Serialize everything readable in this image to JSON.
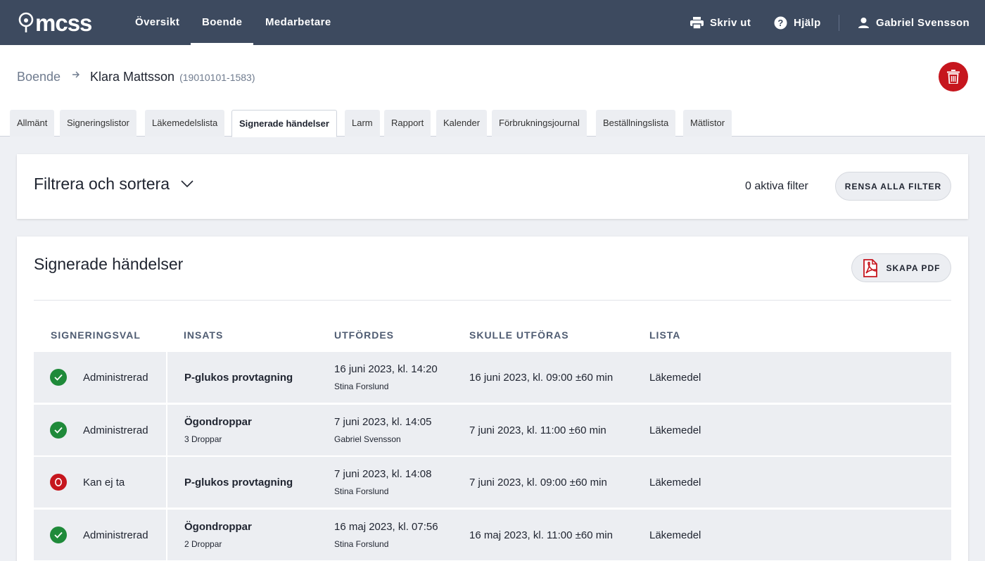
{
  "topbar": {
    "logo": "mcss",
    "nav": [
      "Översikt",
      "Boende",
      "Medarbetare"
    ],
    "active_nav": "Boende",
    "print_label": "Skriv ut",
    "help_label": "Hjälp",
    "user_name": "Gabriel Svensson",
    "bg_color": "#3d4a5f"
  },
  "header": {
    "breadcrumb_link": "Boende",
    "person_name": "Klara Mattsson",
    "person_id": "(19010101-1583)",
    "tabs": [
      "Allmänt",
      "Signeringslistor",
      "Läkemedelslista",
      "Signerade händelser",
      "Larm",
      "Rapport",
      "Kalender",
      "Förbrukningsjournal",
      "Beställningslista",
      "Mätlistor"
    ],
    "active_tab": "Signerade händelser"
  },
  "filter": {
    "title": "Filtrera och sortera",
    "active_count": "0 aktiva filter",
    "clear_label": "RENSA ALLA FILTER"
  },
  "events": {
    "title": "Signerade händelser",
    "pdf_label": "SKAPA PDF",
    "columns": [
      "SIGNERINGSVAL",
      "INSATS",
      "UTFÖRDES",
      "SKULLE UTFÖRAS",
      "LISTA"
    ],
    "rows": [
      {
        "status": "ok",
        "status_label": "Administrerad",
        "insats": "P-glukos provtagning",
        "insats_sub": "",
        "utfordes": "16 juni 2023, kl. 14:20",
        "utfordes_by": "Stina Forslund",
        "skulle": "16 juni 2023, kl. 09:00 ±60 min",
        "lista": "Läkemedel"
      },
      {
        "status": "ok",
        "status_label": "Administrerad",
        "insats": "Ögondroppar",
        "insats_sub": "3 Droppar",
        "utfordes": "7 juni 2023, kl. 14:05",
        "utfordes_by": "Gabriel Svensson",
        "skulle": "7 juni 2023, kl. 11:00 ±60 min",
        "lista": "Läkemedel"
      },
      {
        "status": "no",
        "status_label": "Kan ej ta",
        "insats": "P-glukos provtagning",
        "insats_sub": "",
        "utfordes": "7 juni 2023, kl. 14:08",
        "utfordes_by": "Stina Forslund",
        "skulle": "7 juni 2023, kl. 09:00 ±60 min",
        "lista": "Läkemedel"
      },
      {
        "status": "ok",
        "status_label": "Administrerad",
        "insats": "Ögondroppar",
        "insats_sub": "2 Droppar",
        "utfordes": "16 maj 2023, kl. 07:56",
        "utfordes_by": "Stina Forslund",
        "skulle": "16 maj 2023, kl. 11:00 ±60 min",
        "lista": "Läkemedel"
      }
    ]
  },
  "colors": {
    "accent_red": "#c6161e",
    "ok_green": "#1f8a3a"
  },
  "icons": [
    "logo-icon",
    "printer-icon",
    "help-icon",
    "user-icon",
    "arrow-right-icon",
    "trash-icon",
    "chevron-down-icon",
    "pdf-icon",
    "check-icon",
    "o-icon"
  ]
}
